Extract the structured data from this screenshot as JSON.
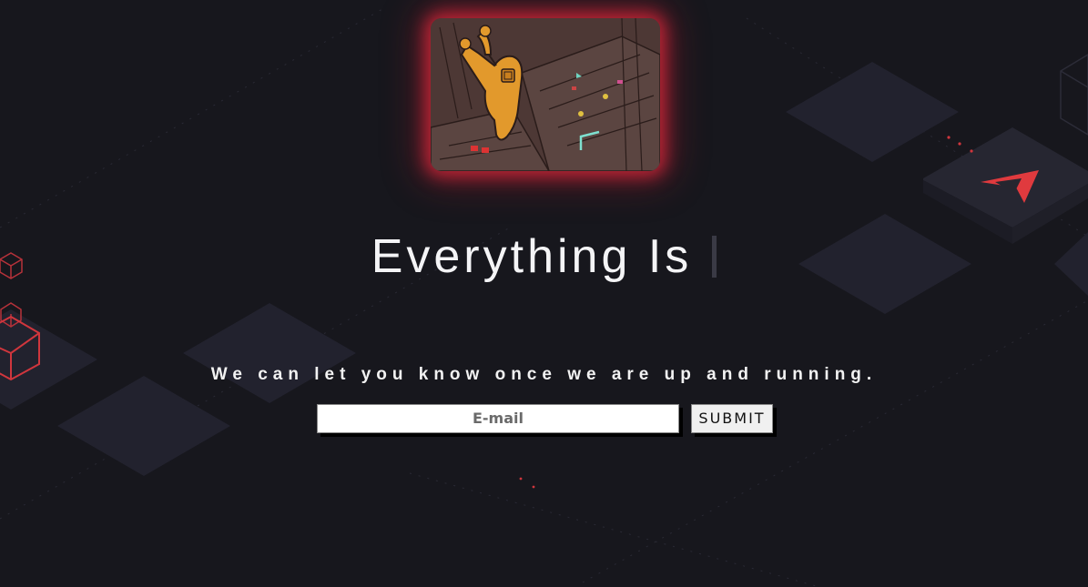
{
  "hero": {
    "illustration": "cartoon-astronaut-floating-in-spaceship-cockpit"
  },
  "headline": {
    "text": "Everything Is"
  },
  "tagline": {
    "text": "We can let you know once we are up and running."
  },
  "signup": {
    "email_placeholder": "E-mail",
    "submit_label": "SUBMIT"
  },
  "colors": {
    "background": "#17171d",
    "tile": "#22222e",
    "accent": "#e03a3e",
    "glow": "#e6283c"
  },
  "icons": {
    "brand": "red-arrow-logo-icon",
    "cubes": "red-wireframe-cube-icon"
  }
}
